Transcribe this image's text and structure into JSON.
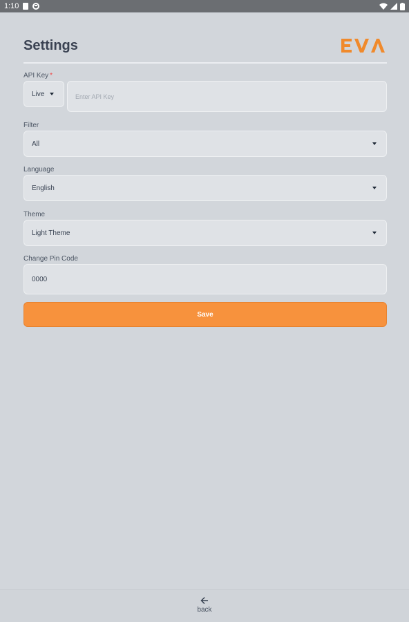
{
  "status_bar": {
    "time": "1:10"
  },
  "header": {
    "title": "Settings",
    "logo_text": "EVA",
    "logo_color": "#f08a2c"
  },
  "form": {
    "api_key": {
      "label": "API Key",
      "required_mark": "*",
      "environment_selected": "Live",
      "placeholder": "Enter API Key",
      "value": ""
    },
    "filter": {
      "label": "Filter",
      "selected": "All"
    },
    "language": {
      "label": "Language",
      "selected": "English"
    },
    "theme": {
      "label": "Theme",
      "selected": "Light Theme"
    },
    "pin": {
      "label": "Change Pin Code",
      "value": "0000"
    },
    "save_label": "Save",
    "accent_color": "#f7923d"
  },
  "bottom_nav": {
    "back_label": "back",
    "back_icon": "arrow-left-icon"
  }
}
